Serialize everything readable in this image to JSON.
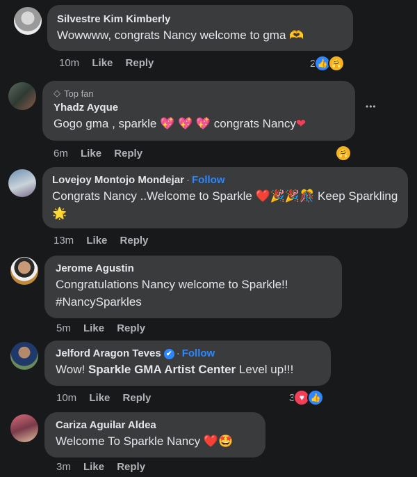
{
  "comments": [
    {
      "name": "Silvestre Kim Kimberly",
      "text": "Wowwww, congrats Nancy welcome to gma 🫶",
      "time": "10m",
      "like": "Like",
      "reply": "Reply",
      "reaction_count": "2",
      "reaction_icons": [
        "like-icon",
        "care-icon"
      ]
    },
    {
      "badge": "Top fan",
      "name": "Yhadz Ayque",
      "text": "Gogo gma , sparkle 💖 💖 💖 congrats Nancy",
      "heart": "❤",
      "time": "6m",
      "like": "Like",
      "reply": "Reply",
      "more": "•••",
      "reaction_icons": [
        "care-icon"
      ]
    },
    {
      "name": "Lovejoy Montojo Mondejar",
      "separator": "·",
      "follow": "Follow",
      "text": "Congrats Nancy ..Welcome to Sparkle ❤️🎉🎉🎊 Keep Sparkling🌟",
      "time": "13m",
      "like": "Like",
      "reply": "Reply"
    },
    {
      "name": "Jerome Agustin",
      "text_line1": "Congratulations Nancy welcome to Sparkle!!",
      "text_line2": "#NancySparkles",
      "time": "5m",
      "like": "Like",
      "reply": "Reply"
    },
    {
      "name": "Jelford Aragon Teves",
      "verified": "✔",
      "separator": "·",
      "follow": "Follow",
      "text_prefix": "Wow!",
      "text_bold": "Sparkle GMA Artist Center",
      "text_suffix": "Level up!!!",
      "time": "10m",
      "like": "Like",
      "reply": "Reply",
      "reaction_count": "3",
      "reaction_icons": [
        "love-icon",
        "like-icon"
      ]
    },
    {
      "name": "Cariza Aguilar Aldea",
      "text": "Welcome To Sparkle Nancy ❤️🤩",
      "time": "3m",
      "like": "Like",
      "reply": "Reply"
    }
  ],
  "colors": {
    "background": "#18191a",
    "bubble": "#3a3b3c",
    "link": "#2d88ff",
    "muted": "#b0b3b8"
  }
}
